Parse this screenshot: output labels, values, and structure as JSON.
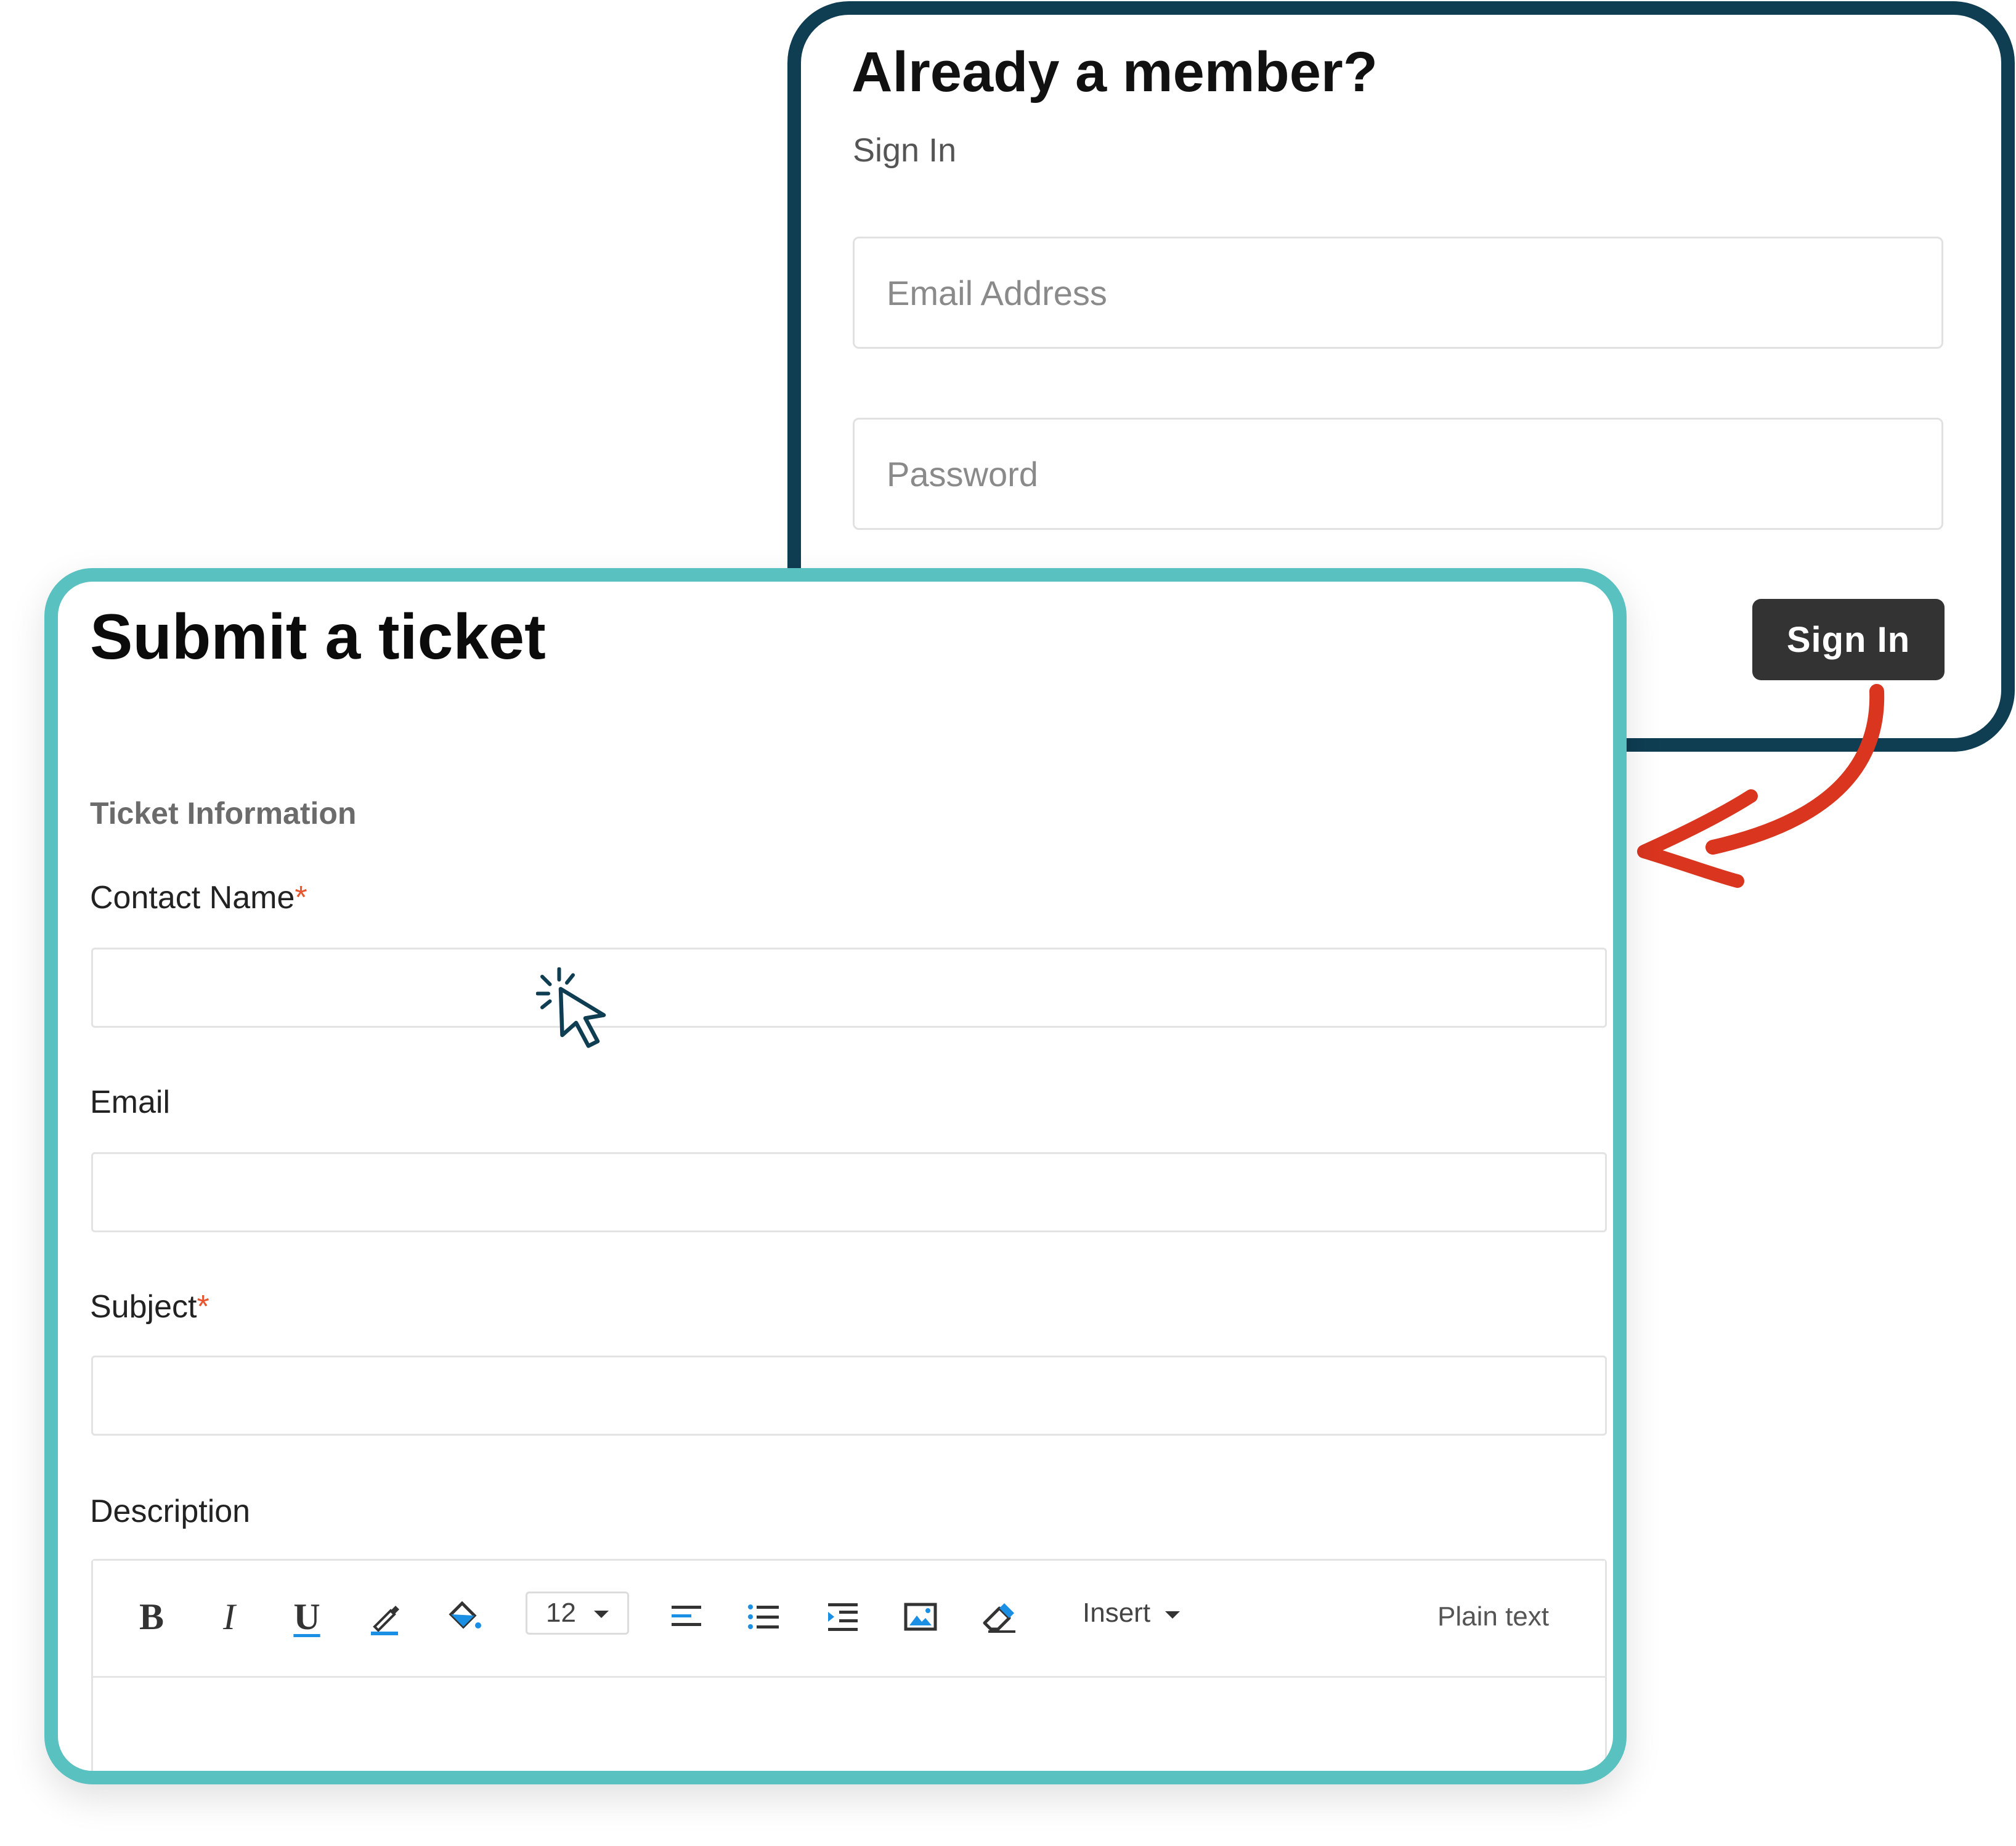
{
  "signin": {
    "title": "Already a member?",
    "subtitle": "Sign In",
    "email_placeholder": "Email Address",
    "password_placeholder": "Password",
    "button_label": "Sign In"
  },
  "ticket": {
    "title": "Submit a ticket",
    "section_title": "Ticket Information",
    "fields": {
      "contact_name": {
        "label": "Contact Name",
        "required_mark": "*",
        "value": ""
      },
      "email": {
        "label": "Email",
        "value": ""
      },
      "subject": {
        "label": "Subject",
        "required_mark": "*",
        "value": ""
      },
      "description": {
        "label": "Description"
      }
    },
    "editor": {
      "font_size": "12",
      "insert_label": "Insert",
      "plain_text_label": "Plain text",
      "toolbar_icons": [
        "bold-icon",
        "italic-icon",
        "underline-icon",
        "text-color-icon",
        "background-color-icon",
        "font-size-select",
        "align-left-icon",
        "bullet-list-icon",
        "indent-icon",
        "image-icon",
        "eraser-icon",
        "insert-menu",
        "plain-text-toggle"
      ]
    }
  },
  "colors": {
    "signin_border": "#0f3d52",
    "ticket_border": "#5ac1c1",
    "button_bg": "#333333",
    "arrow": "#d9351f",
    "required": "#e8562f",
    "accent_blue": "#1a8fe3"
  }
}
